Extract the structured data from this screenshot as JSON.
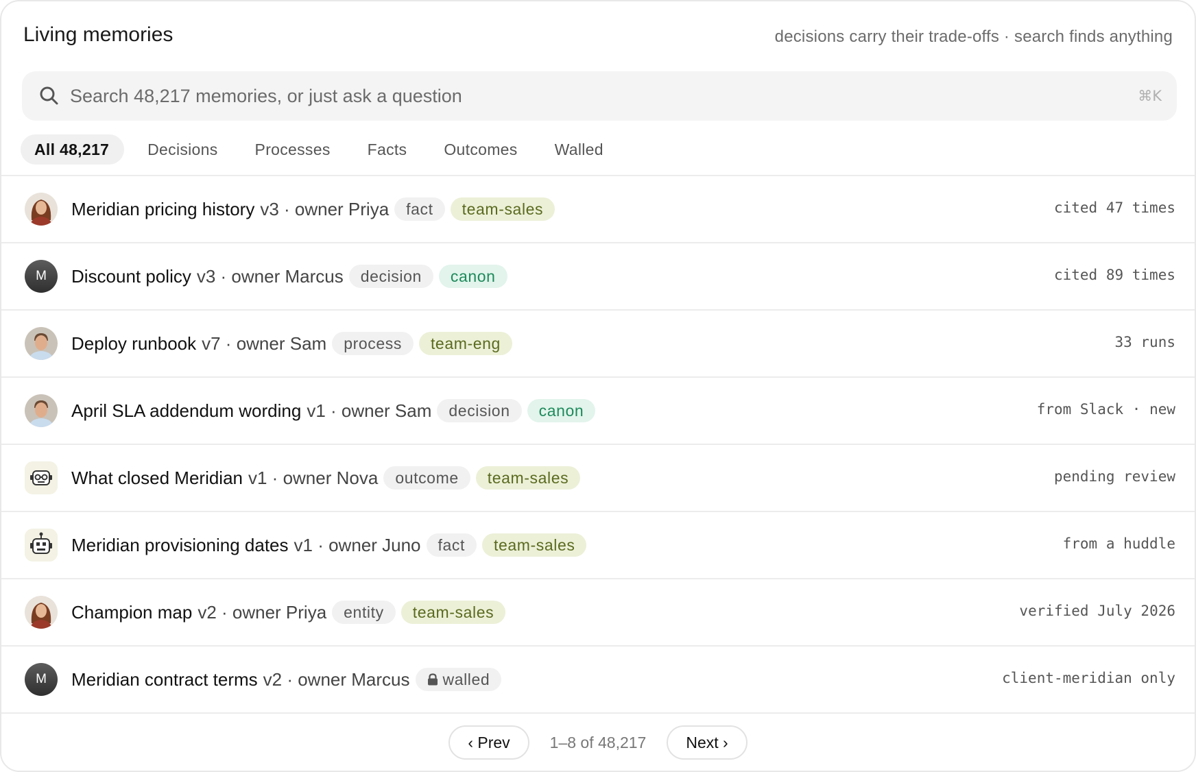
{
  "header": {
    "title": "Living memories",
    "tagline": "decisions carry their trade-offs · search finds anything"
  },
  "search": {
    "placeholder": "Search 48,217 memories, or just ask a question",
    "shortcut": "⌘K",
    "icon": "search-icon"
  },
  "tabs": [
    {
      "label": "All 48,217",
      "active": true
    },
    {
      "label": "Decisions",
      "active": false
    },
    {
      "label": "Processes",
      "active": false
    },
    {
      "label": "Facts",
      "active": false
    },
    {
      "label": "Outcomes",
      "active": false
    },
    {
      "label": "Walled",
      "active": false
    }
  ],
  "memories": [
    {
      "name": "Meridian pricing history",
      "meta": "v3 · owner Priya",
      "kind": "fact",
      "tag": "team-sales",
      "tag_style": "team",
      "status": "cited 47 times",
      "avatar": "photo-woman"
    },
    {
      "name": "Discount policy",
      "meta": "v3 · owner Marcus",
      "kind": "decision",
      "tag": "canon",
      "tag_style": "canon",
      "status": "cited 89 times",
      "avatar": "initial",
      "avatar_initial": "M"
    },
    {
      "name": "Deploy runbook",
      "meta": "v7 · owner Sam",
      "kind": "process",
      "tag": "team-eng",
      "tag_style": "team",
      "status": "33 runs",
      "avatar": "photo-man"
    },
    {
      "name": "April SLA addendum wording",
      "meta": "v1 · owner Sam",
      "kind": "decision",
      "tag": "canon",
      "tag_style": "canon",
      "status": "from Slack · new",
      "avatar": "photo-man"
    },
    {
      "name": "What closed Meridian",
      "meta": "v1 · owner Nova",
      "kind": "outcome",
      "tag": "team-sales",
      "tag_style": "team",
      "status": "pending review",
      "avatar": "bot-nova"
    },
    {
      "name": "Meridian provisioning dates",
      "meta": "v1 · owner Juno",
      "kind": "fact",
      "tag": "team-sales",
      "tag_style": "team",
      "status": "from a huddle",
      "avatar": "bot-juno"
    },
    {
      "name": "Champion map",
      "meta": "v2 · owner Priya",
      "kind": "entity",
      "tag": "team-sales",
      "tag_style": "team",
      "status": "verified July 2026",
      "avatar": "photo-woman"
    },
    {
      "name": "Meridian contract terms",
      "meta": "v2 · owner Marcus",
      "kind": "walled",
      "lock_icon": "lock-icon",
      "tag": "",
      "tag_style": "",
      "status": "client-meridian only",
      "avatar": "initial",
      "avatar_initial": "M"
    }
  ],
  "pagination": {
    "prev_label": "‹ Prev",
    "range_label": "1–8 of 48,217",
    "next_label": "Next ›"
  },
  "colors": {
    "team_pill_bg": "#ecf0d7",
    "team_pill_text": "#5a6a1f",
    "canon_pill_bg": "#e2f4ec",
    "canon_pill_text": "#1e8a5b",
    "neutral_pill_bg": "#f1f1f1"
  }
}
